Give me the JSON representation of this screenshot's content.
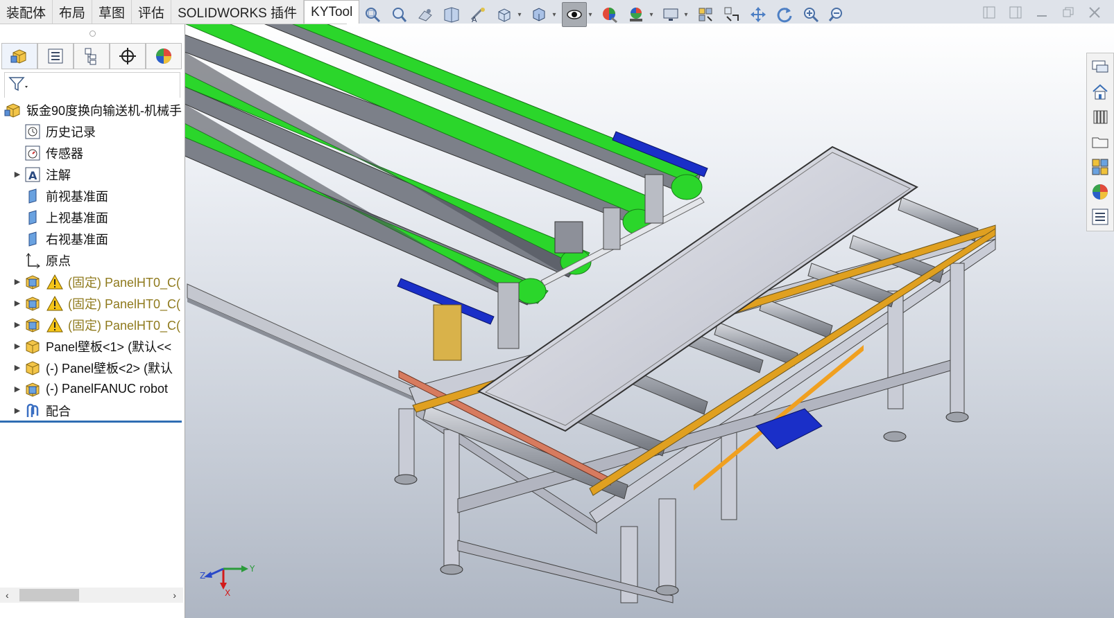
{
  "tabs": [
    {
      "label": "装配体"
    },
    {
      "label": "布局"
    },
    {
      "label": "草图"
    },
    {
      "label": "评估"
    },
    {
      "label": "SOLIDWORKS 插件"
    },
    {
      "label": "KYTool"
    }
  ],
  "view_toolbar_icons": [
    "zoom-to-fit-icon",
    "zoom-to-area-icon",
    "previous-view-icon",
    "section-view-icon",
    "dynamic-annotation-icon",
    "view-orientation-icon",
    "display-style-icon",
    "hide-show-items-icon",
    "edit-appearance-icon",
    "apply-scene-icon",
    "view-settings-icon",
    "rotate-view-icon",
    "pan-icon",
    "move-icon",
    "rotate-icon",
    "zoom-in-icon",
    "zoom-out-icon"
  ],
  "feature_tree": {
    "root": "钣金90度换向输送机-机械手",
    "items": [
      {
        "label": "历史记录",
        "icon": "history-icon",
        "expandable": false
      },
      {
        "label": "传感器",
        "icon": "sensor-icon",
        "expandable": false
      },
      {
        "label": "注解",
        "icon": "annotation-icon",
        "expandable": true
      },
      {
        "label": "前视基准面",
        "icon": "plane-icon",
        "expandable": false
      },
      {
        "label": "上视基准面",
        "icon": "plane-icon",
        "expandable": false
      },
      {
        "label": "右视基准面",
        "icon": "plane-icon",
        "expandable": false
      },
      {
        "label": "原点",
        "icon": "origin-icon",
        "expandable": false
      },
      {
        "label": "(固定) PanelHT0_C(",
        "icon": "part-icon",
        "expandable": true,
        "warning": true
      },
      {
        "label": "(固定) PanelHT0_C(",
        "icon": "part-icon",
        "expandable": true,
        "warning": true
      },
      {
        "label": "(固定) PanelHT0_C(",
        "icon": "part-icon",
        "expandable": true,
        "warning": true
      },
      {
        "label": "Panel壁板<1> (默认<<",
        "icon": "assembly-icon",
        "expandable": true
      },
      {
        "label": "(-) Panel壁板<2> (默认",
        "icon": "assembly-icon",
        "expandable": true
      },
      {
        "label": "(-) PanelFANUC robot",
        "icon": "part-icon",
        "expandable": true
      },
      {
        "label": "配合",
        "icon": "mates-icon",
        "expandable": true
      }
    ]
  },
  "triad": {
    "x": "X",
    "y": "Y",
    "z": "Z"
  },
  "colors": {
    "belt": "#2bd62b",
    "blue_bar": "#1a2fc8",
    "frame": "#c9ccd6",
    "accent": "#e0a020",
    "selection_line": "#2f6db3"
  }
}
